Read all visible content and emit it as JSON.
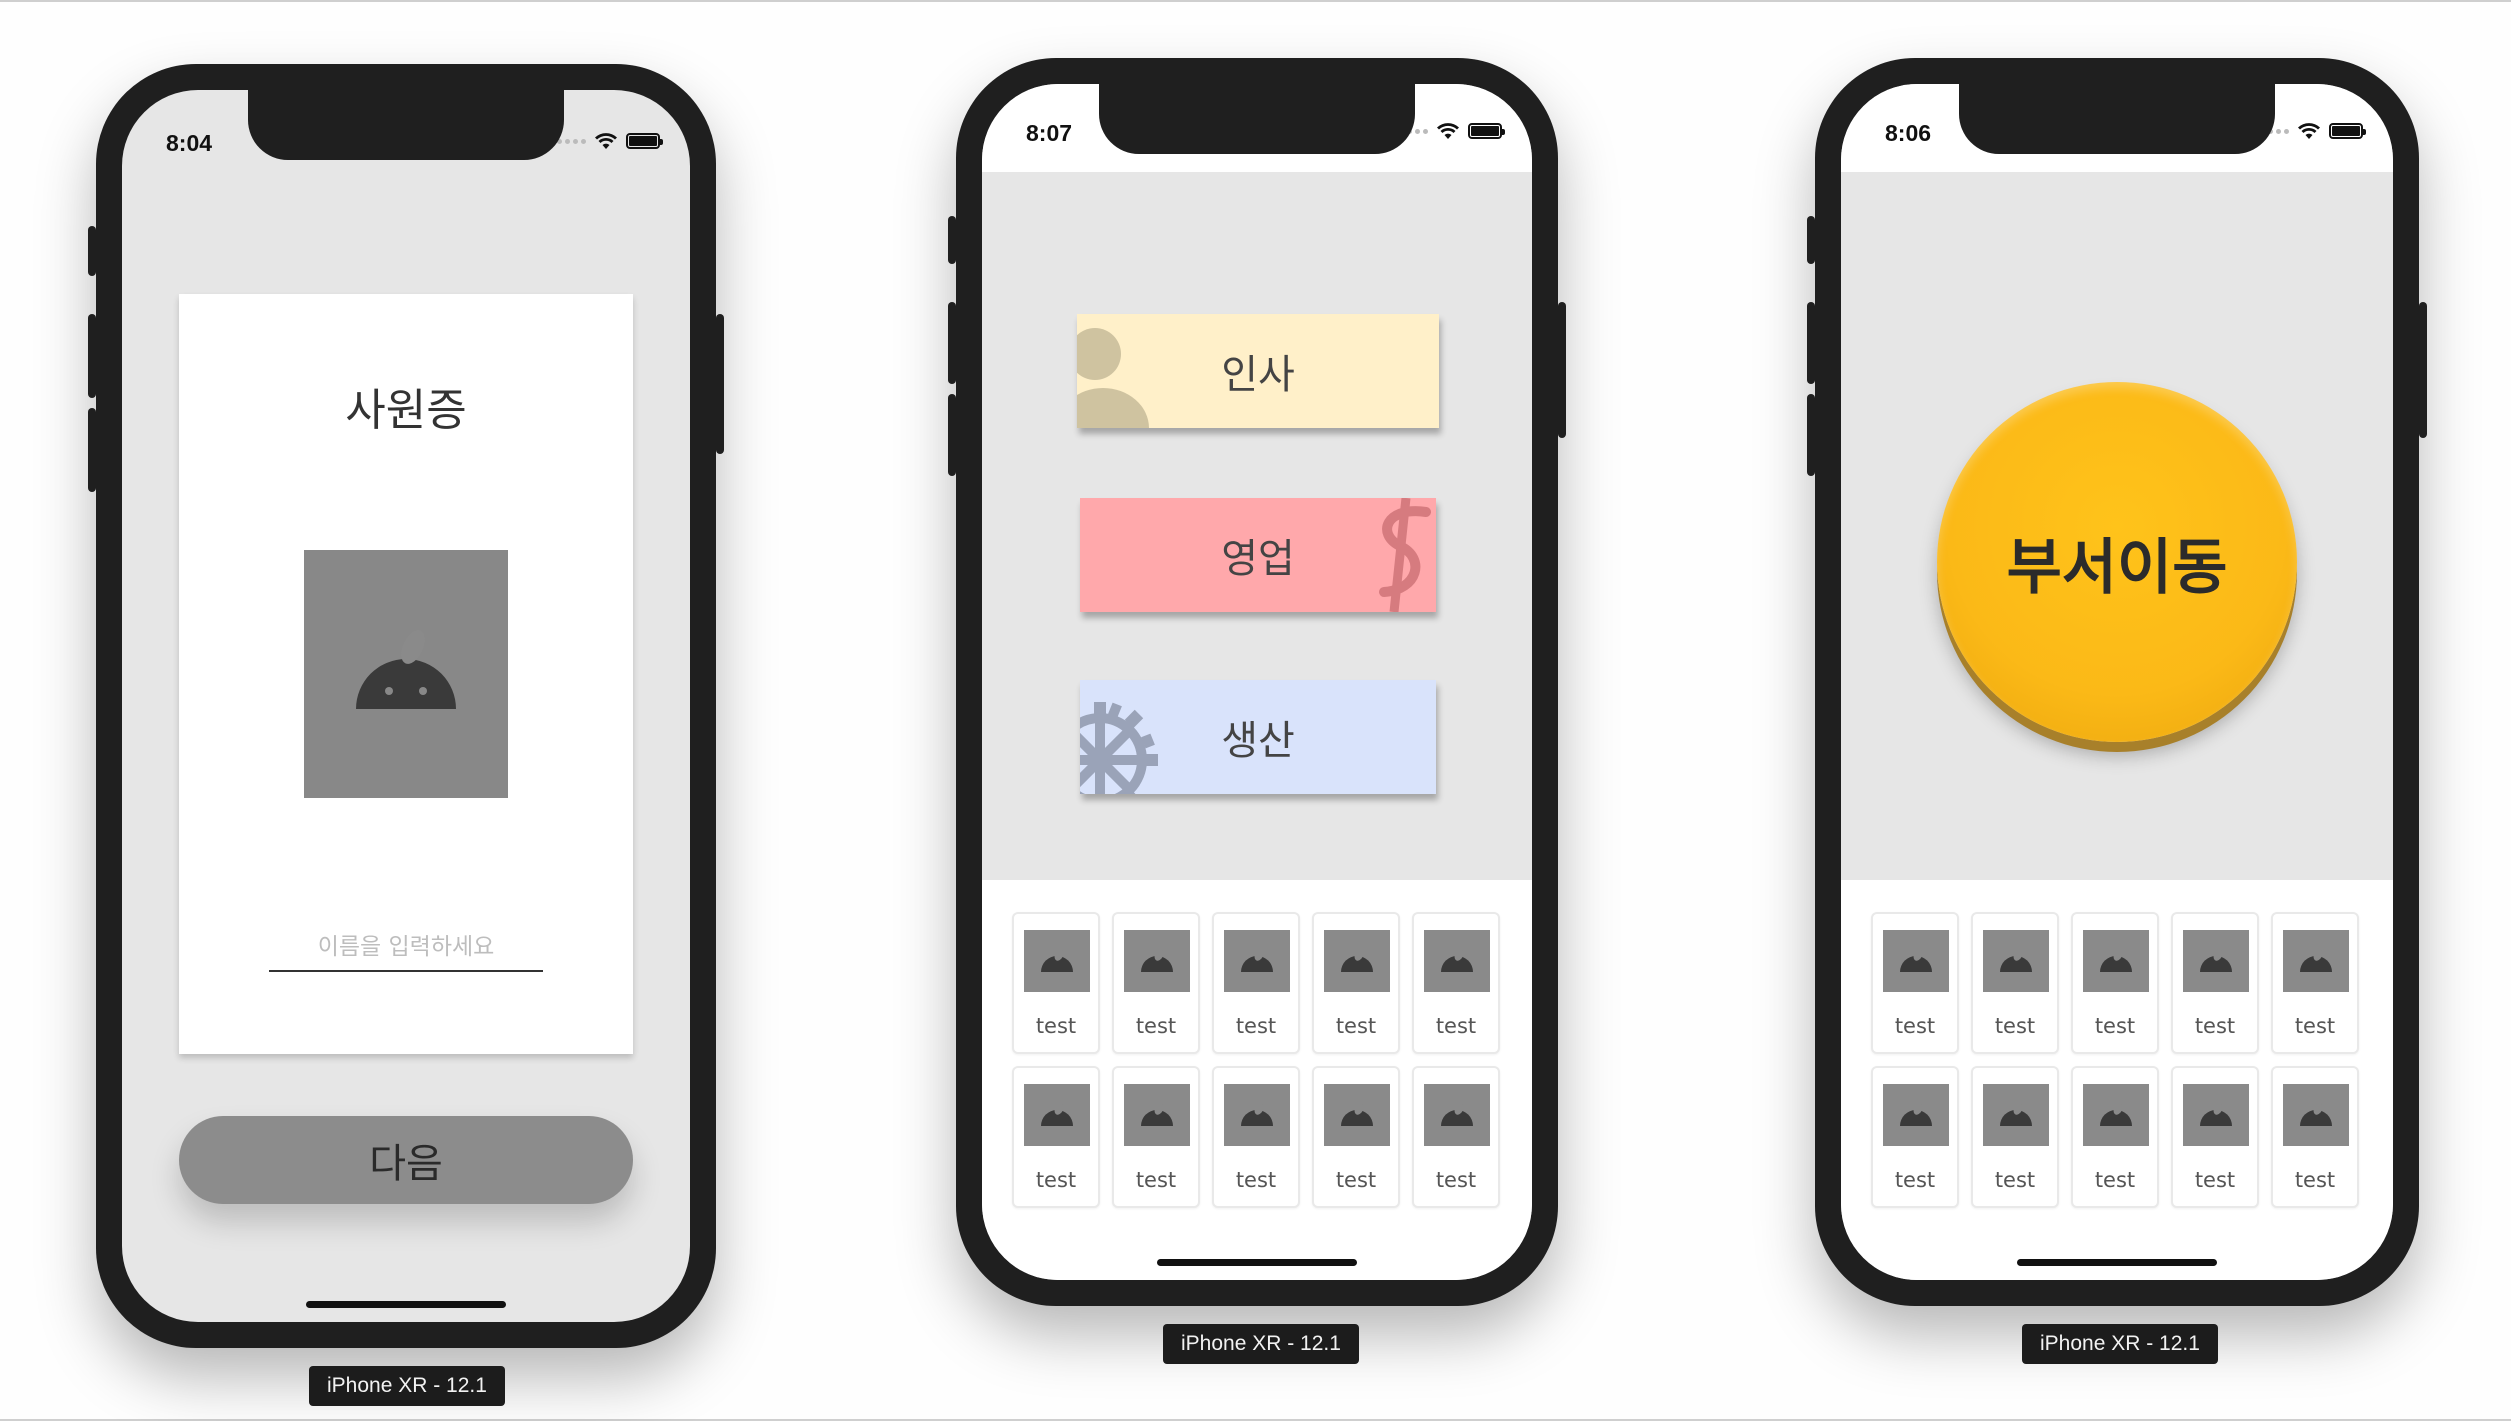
{
  "phones": [
    {
      "time": "8:04",
      "label": "iPhone XR - 12.1"
    },
    {
      "time": "8:07",
      "label": "iPhone XR - 12.1"
    },
    {
      "time": "8:06",
      "label": "iPhone XR - 12.1"
    }
  ],
  "id_card": {
    "title": "사원증",
    "name_placeholder": "이름을 입력하세요",
    "next_label": "다음"
  },
  "departments": [
    {
      "label": "인사",
      "color": "#fff0c9",
      "icon": "person-icon"
    },
    {
      "label": "영업",
      "color": "#ffa8ab",
      "icon": "dollar-icon"
    },
    {
      "label": "생산",
      "color": "#d9e3fb",
      "icon": "gear-icon"
    }
  ],
  "grid_tiles": [
    "test",
    "test",
    "test",
    "test",
    "test",
    "test",
    "test",
    "test",
    "test",
    "test"
  ],
  "transfer": {
    "label": "부서이동",
    "color": "#fbb917"
  },
  "colors": {
    "screen_bg": "#e6e6e6",
    "frame": "#1f1f1f",
    "placeholder_gray": "#888888",
    "next_button": "#8c8c8c"
  }
}
